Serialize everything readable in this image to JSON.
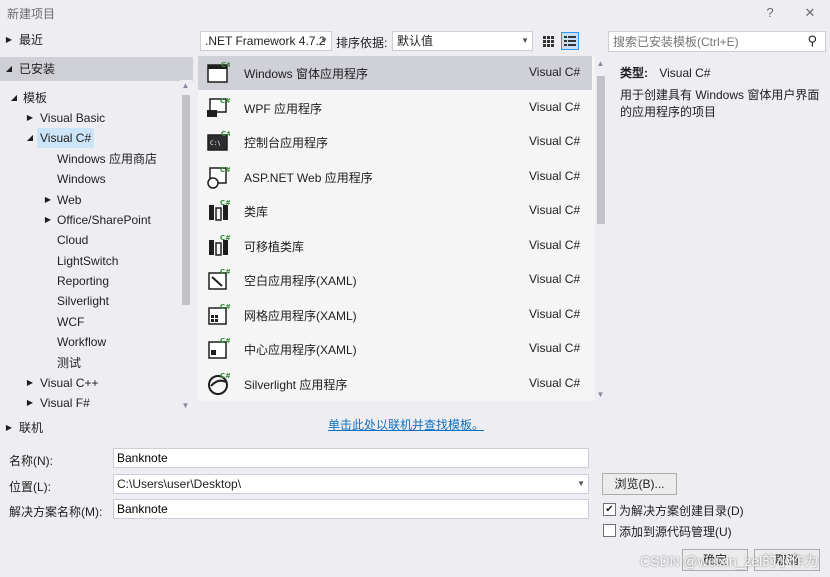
{
  "window": {
    "title": "新建项目",
    "help_label": "?",
    "close_label": "✕"
  },
  "left_tree": {
    "recent": "最近",
    "installed": "已安装",
    "templates": "模板",
    "visual_basic": "Visual Basic",
    "visual_csharp": "Visual C#",
    "csharp_children": [
      "Windows 应用商店",
      "Windows",
      "Web",
      "Office/SharePoint",
      "Cloud",
      "LightSwitch",
      "Reporting",
      "Silverlight",
      "WCF",
      "Workflow",
      "测试"
    ],
    "visual_cpp": "Visual C++",
    "visual_fsharp": "Visual F#",
    "online": "联机"
  },
  "toolbar": {
    "framework": ".NET Framework 4.7.2",
    "sort_label": "排序依据:",
    "sort_value": "默认值",
    "search_placeholder": "搜索已安装模板(Ctrl+E)"
  },
  "templates": [
    {
      "name": "Windows 窗体应用程序",
      "lang": "Visual C#",
      "icon": "windows-forms-icon"
    },
    {
      "name": "WPF 应用程序",
      "lang": "Visual C#",
      "icon": "wpf-icon"
    },
    {
      "name": "控制台应用程序",
      "lang": "Visual C#",
      "icon": "console-icon"
    },
    {
      "name": "ASP.NET Web 应用程序",
      "lang": "Visual C#",
      "icon": "web-app-icon"
    },
    {
      "name": "类库",
      "lang": "Visual C#",
      "icon": "class-library-icon"
    },
    {
      "name": "可移植类库",
      "lang": "Visual C#",
      "icon": "portable-library-icon"
    },
    {
      "name": "空白应用程序(XAML)",
      "lang": "Visual C#",
      "icon": "blank-app-icon"
    },
    {
      "name": "网格应用程序(XAML)",
      "lang": "Visual C#",
      "icon": "grid-app-icon"
    },
    {
      "name": "中心应用程序(XAML)",
      "lang": "Visual C#",
      "icon": "hub-app-icon"
    },
    {
      "name": "Silverlight 应用程序",
      "lang": "Visual C#",
      "icon": "silverlight-icon"
    }
  ],
  "info": {
    "type_label": "类型:",
    "type_value": "Visual C#",
    "description": "用于创建具有 Windows 窗体用户界面的应用程序的项目"
  },
  "online_link": "单击此处以联机并查找模板。",
  "form": {
    "name_label": "名称(N):",
    "name_value": "Banknote",
    "location_label": "位置(L):",
    "location_value": "C:\\Users\\user\\Desktop\\",
    "solution_label": "解决方案名称(M):",
    "solution_value": "Banknote",
    "browse_label": "浏览(B)...",
    "create_dir_label": "为解决方案创建目录(D)",
    "source_control_label": "添加到源代码管理(U)",
    "ok_label": "确定",
    "cancel_label": "取消",
    "watermark": "CSDN @weixin_zel的小作为"
  },
  "colors": {
    "accent": "#68217a",
    "selection": "#cce4f7",
    "link": "#0e70c0",
    "csharp_green": "#388a34"
  }
}
